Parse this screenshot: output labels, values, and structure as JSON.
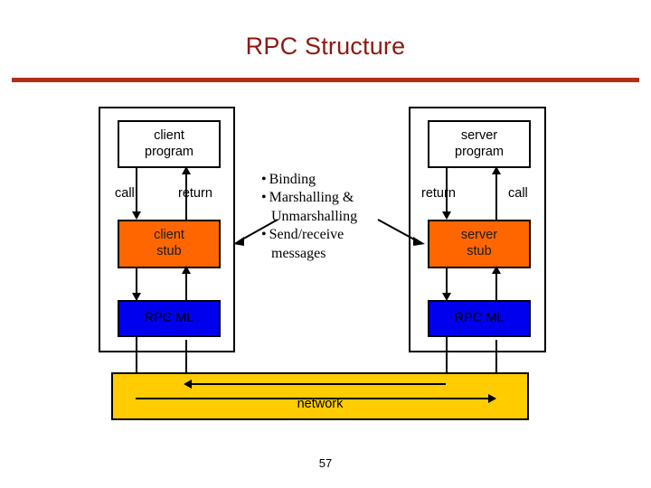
{
  "slide": {
    "title": "RPC Structure",
    "page_number": "57",
    "accent_color": "#8C1A11",
    "rule_color": "#B1301A"
  },
  "colors": {
    "stub_fill": "#FF6600",
    "rpcml_fill": "#0000EE",
    "network_fill": "#FFCC00",
    "outline": "#000000",
    "program_fill": "#FFFFFF"
  },
  "client_side": {
    "program": {
      "line1": "client",
      "line2": "program"
    },
    "call_label": "call",
    "return_label": "return",
    "stub": {
      "line1": "client",
      "line2": "stub"
    },
    "rpcml": {
      "label": "RPC ML"
    }
  },
  "server_side": {
    "program": {
      "line1": "server",
      "line2": "program"
    },
    "return_label": "return",
    "call_label": "call",
    "stub": {
      "line1": "server",
      "line2": "stub"
    },
    "rpcml": {
      "label": "RPC ML"
    }
  },
  "center_notes": {
    "bullet_char": "•",
    "items": [
      {
        "first": "Binding",
        "cont": ""
      },
      {
        "first": "Marshalling &",
        "cont": "Unmarshalling"
      },
      {
        "first": "Send/receive",
        "cont": "messages"
      }
    ]
  },
  "network": {
    "label": "network"
  }
}
